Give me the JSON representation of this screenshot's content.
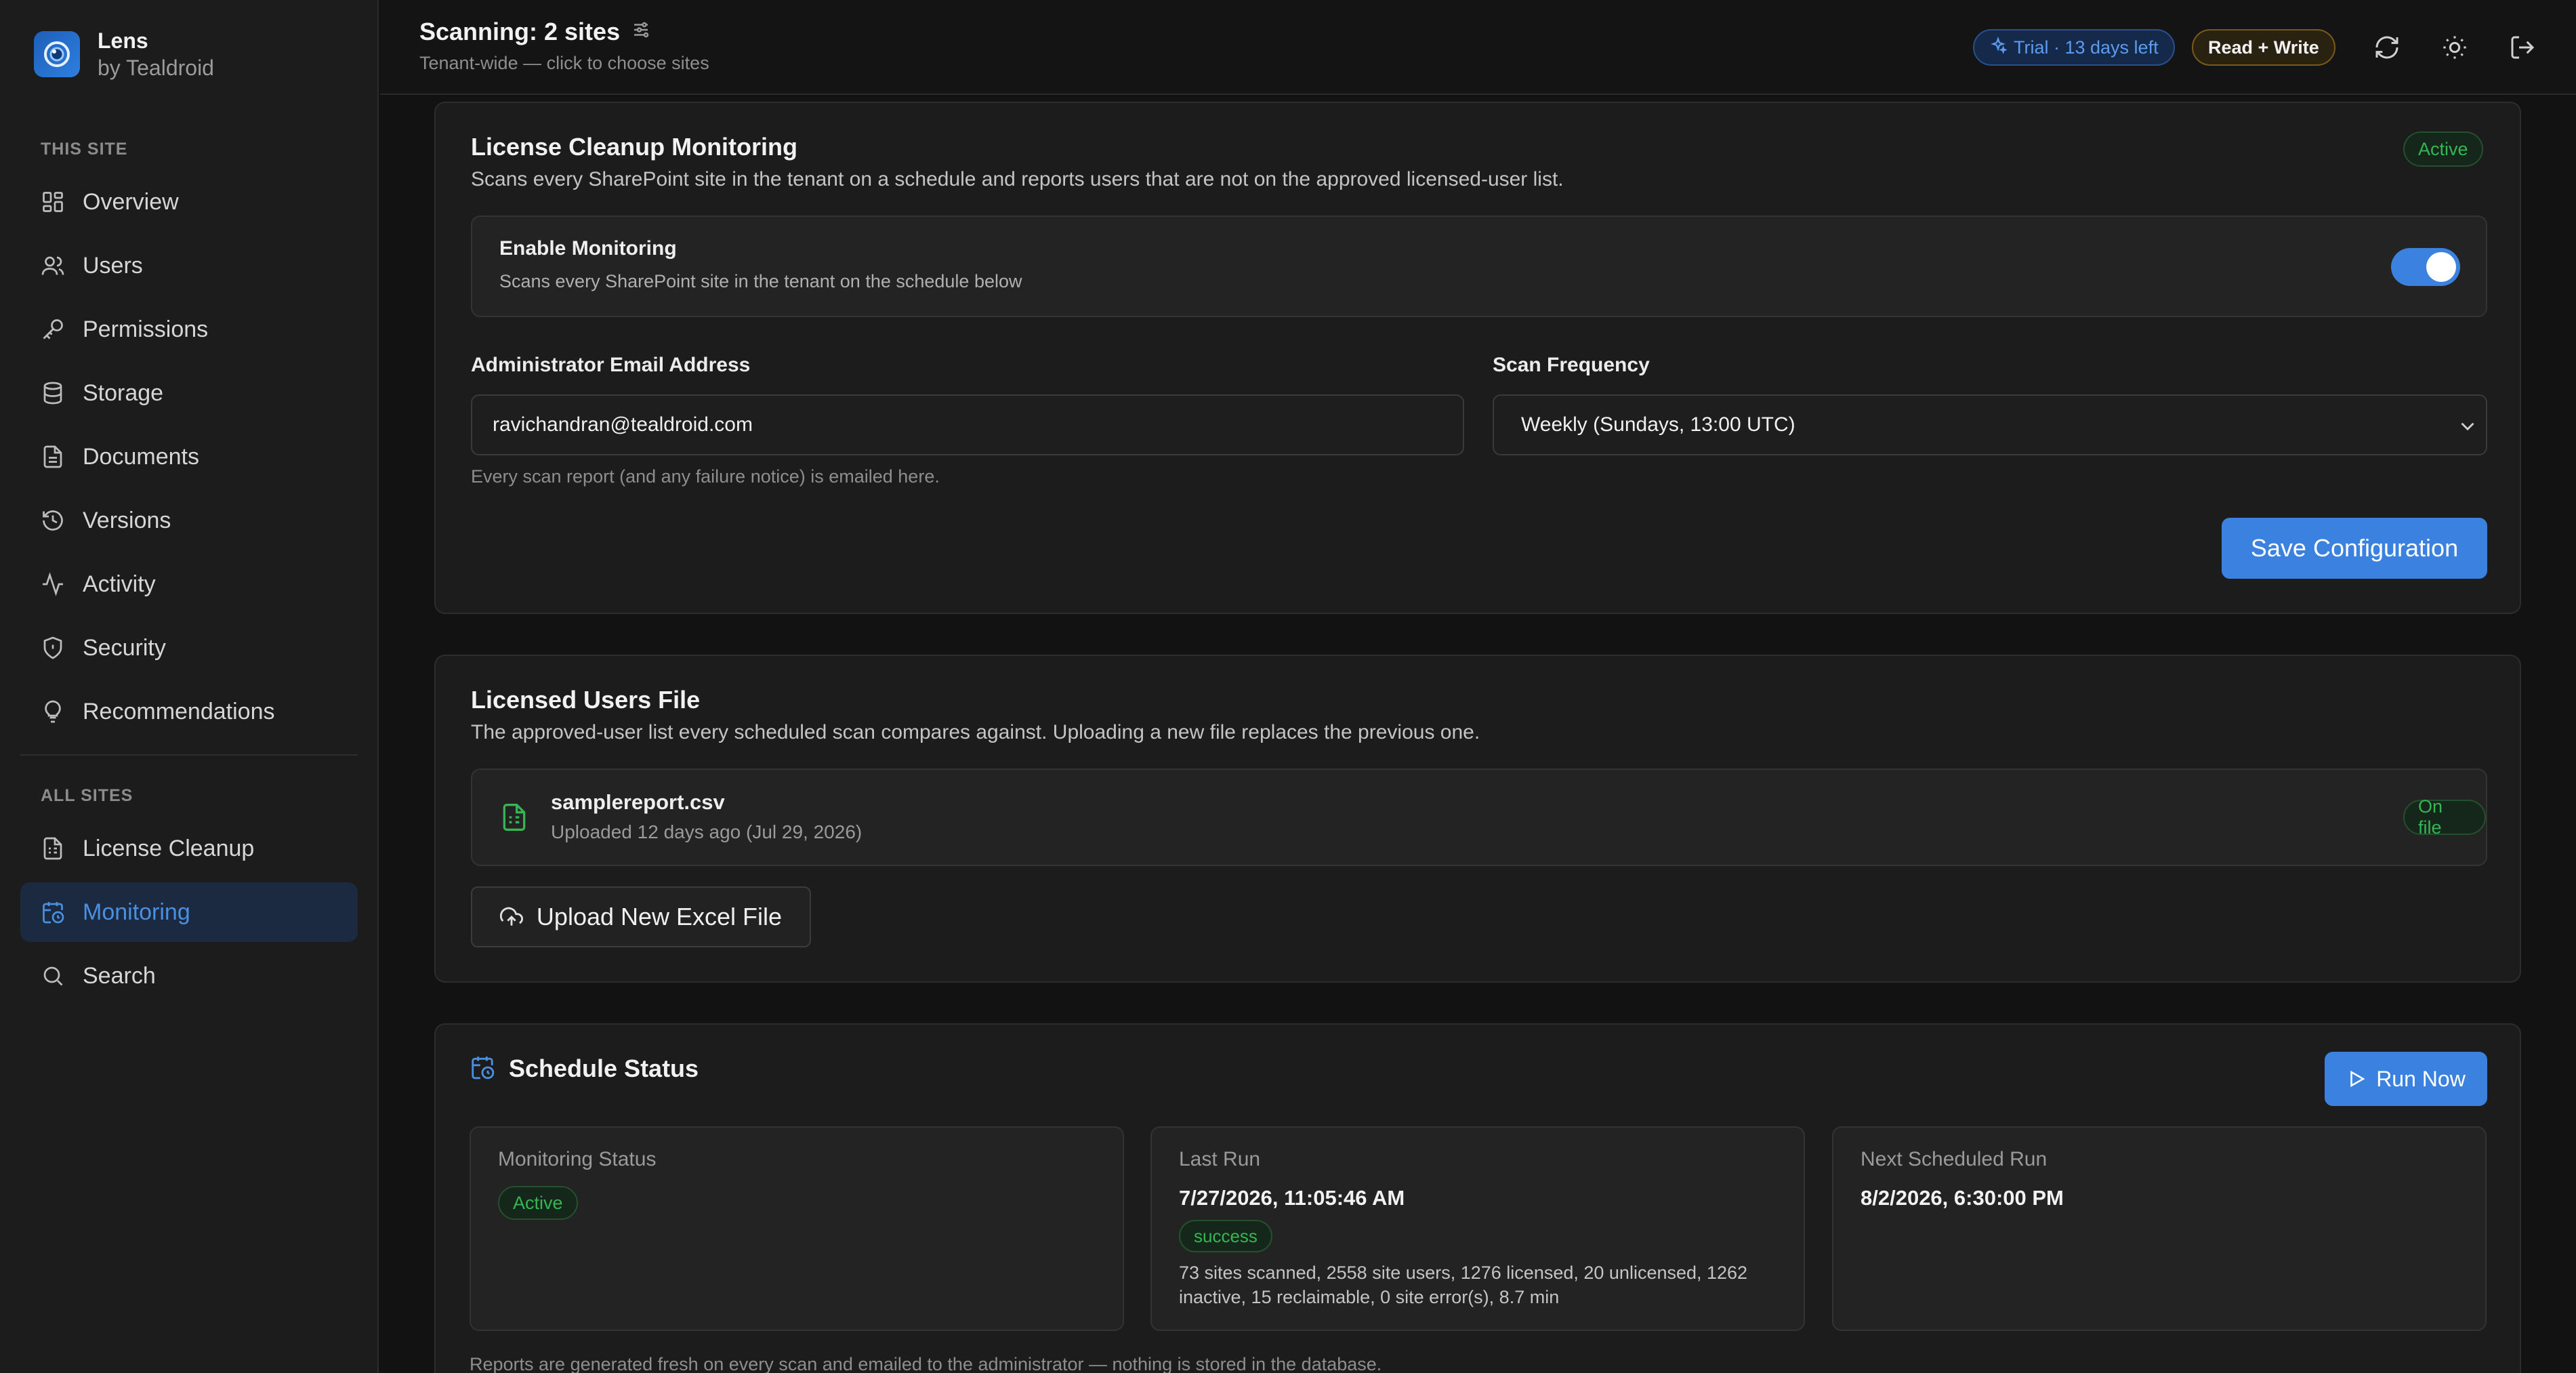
{
  "brand": {
    "name": "Lens",
    "sub": "by Tealdroid"
  },
  "sidebar": {
    "section_this_site": "THIS SITE",
    "section_all_sites": "ALL SITES",
    "items": [
      {
        "label": "Overview",
        "icon": "grid-icon"
      },
      {
        "label": "Users",
        "icon": "users-icon"
      },
      {
        "label": "Permissions",
        "icon": "key-icon"
      },
      {
        "label": "Storage",
        "icon": "database-icon"
      },
      {
        "label": "Documents",
        "icon": "document-icon"
      },
      {
        "label": "Versions",
        "icon": "history-icon"
      },
      {
        "label": "Activity",
        "icon": "activity-icon"
      },
      {
        "label": "Security",
        "icon": "shield-icon"
      },
      {
        "label": "Recommendations",
        "icon": "lightbulb-icon"
      }
    ],
    "all_items": [
      {
        "label": "License Cleanup",
        "icon": "sheet-icon"
      },
      {
        "label": "Monitoring",
        "icon": "calendar-clock-icon",
        "active": true
      },
      {
        "label": "Search",
        "icon": "search-icon"
      }
    ]
  },
  "topbar": {
    "title": "Scanning: 2 sites",
    "subtitle": "Tenant-wide — click to choose sites",
    "trial": "Trial · 13 days left",
    "mode": "Read + Write"
  },
  "monitoring": {
    "title": "License Cleanup Monitoring",
    "description": "Scans every SharePoint site in the tenant on a schedule and reports users that are not on the approved licensed-user list.",
    "status": "Active",
    "enable_title": "Enable Monitoring",
    "enable_desc": "Scans every SharePoint site in the tenant on the schedule below",
    "enabled": true,
    "email_label": "Administrator Email Address",
    "email_value": "ravichandran@tealdroid.com",
    "email_hint": "Every scan report (and any failure notice) is emailed here.",
    "freq_label": "Scan Frequency",
    "freq_value": "Weekly (Sundays, 13:00 UTC)",
    "save_label": "Save Configuration"
  },
  "licensed": {
    "title": "Licensed Users File",
    "description": "The approved-user list every scheduled scan compares against. Uploading a new file replaces the previous one.",
    "file_name": "samplereport.csv",
    "file_meta": "Uploaded 12 days ago (Jul 29, 2026)",
    "file_status": "On file",
    "upload_label": "Upload New Excel File"
  },
  "schedule": {
    "title": "Schedule Status",
    "run_label": "Run Now",
    "monitoring_status_label": "Monitoring Status",
    "monitoring_status_value": "Active",
    "last_run_label": "Last Run",
    "last_run_value": "7/27/2026, 11:05:46 AM",
    "last_run_status": "success",
    "last_run_summary": "73 sites scanned, 2558 site users, 1276 licensed, 20 unlicensed, 1262 inactive, 15 reclaimable, 0 site error(s), 8.7 min",
    "next_run_label": "Next Scheduled Run",
    "next_run_value": "8/2/2026, 6:30:00 PM",
    "footnote": "Reports are generated fresh on every scan and emailed to the administrator — nothing is stored in the database."
  },
  "colors": {
    "accent": "#3b82e0",
    "success": "#35b553",
    "background": "#121212",
    "card": "#1c1c1c"
  }
}
